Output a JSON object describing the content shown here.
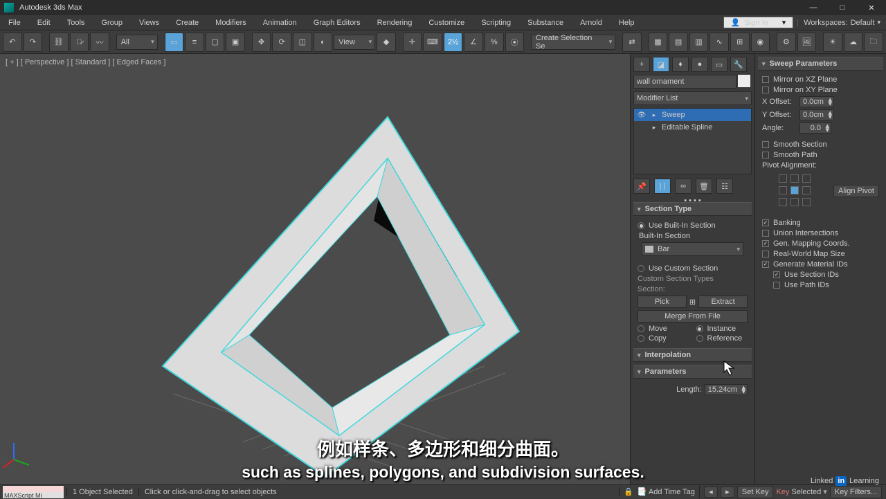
{
  "app": {
    "title": "Autodesk 3ds Max"
  },
  "menu": {
    "items": [
      "File",
      "Edit",
      "Tools",
      "Group",
      "Views",
      "Create",
      "Modifiers",
      "Animation",
      "Graph Editors",
      "Rendering",
      "Customize",
      "Scripting",
      "Substance",
      "Arnold",
      "Help"
    ]
  },
  "signin": {
    "label": "Sign In"
  },
  "workspaces": {
    "label": "Workspaces:",
    "value": "Default"
  },
  "toolbar": {
    "drop1": "All",
    "drop2": "View",
    "selset": "Create Selection Se"
  },
  "viewport": {
    "label": "[ + ] [ Perspective ] [ Standard ] [ Edged Faces ]"
  },
  "mod": {
    "objectName": "wall ornament",
    "listLabel": "Modifier List",
    "stack": [
      {
        "name": "Sweep",
        "sel": true
      },
      {
        "name": "Editable Spline",
        "sel": false
      }
    ]
  },
  "section": {
    "title": "Section Type",
    "useBuiltIn": "Use Built-In Section",
    "builtInLabel": "Built-In Section",
    "builtInValue": "Bar",
    "useCustom": "Use Custom Section",
    "customTypes": "Custom Section Types",
    "sectionLabel": "Section:",
    "pick": "Pick",
    "extract": "Extract",
    "mergeFrom": "Merge From File",
    "move": "Move",
    "instance": "Instance",
    "copy": "Copy",
    "reference": "Reference"
  },
  "interp": {
    "title": "Interpolation"
  },
  "params": {
    "title": "Parameters",
    "lengthLabel": "Length:",
    "lengthVal": "15.24cm"
  },
  "sweep": {
    "title": "Sweep Parameters",
    "mirrorXZ": "Mirror on XZ Plane",
    "mirrorXY": "Mirror on XY Plane",
    "xoffLbl": "X Offset:",
    "xoffVal": "0.0cm",
    "yoffLbl": "Y Offset:",
    "yoffVal": "0.0cm",
    "angleLbl": "Angle:",
    "angleVal": "0.0",
    "smoothSection": "Smooth Section",
    "smoothPath": "Smooth Path",
    "pivotAlign": "Pivot Alignment:",
    "alignPivot": "Align Pivot",
    "banking": "Banking",
    "unionInt": "Union Intersections",
    "genMap": "Gen. Mapping Coords.",
    "realWorld": "Real-World Map Size",
    "genMat": "Generate Material IDs",
    "useSec": "Use Section IDs",
    "usePath": "Use Path IDs"
  },
  "status": {
    "selected": "1 Object Selected",
    "maxscript": "MAXScript Mi",
    "prompt": "Click or click-and-drag to select objects",
    "addTimeTag": "Add Time Tag",
    "setKey": "Set Key",
    "keyFilters": "Key Filters...",
    "selected2": "Selected"
  },
  "subtitles": {
    "cn": "例如样条、多边形和细分曲面。",
    "en": "such as splines, polygons, and subdivision surfaces."
  },
  "linkedin": {
    "prefix": "Linked",
    "in": "in",
    "suffix": "Learning"
  }
}
